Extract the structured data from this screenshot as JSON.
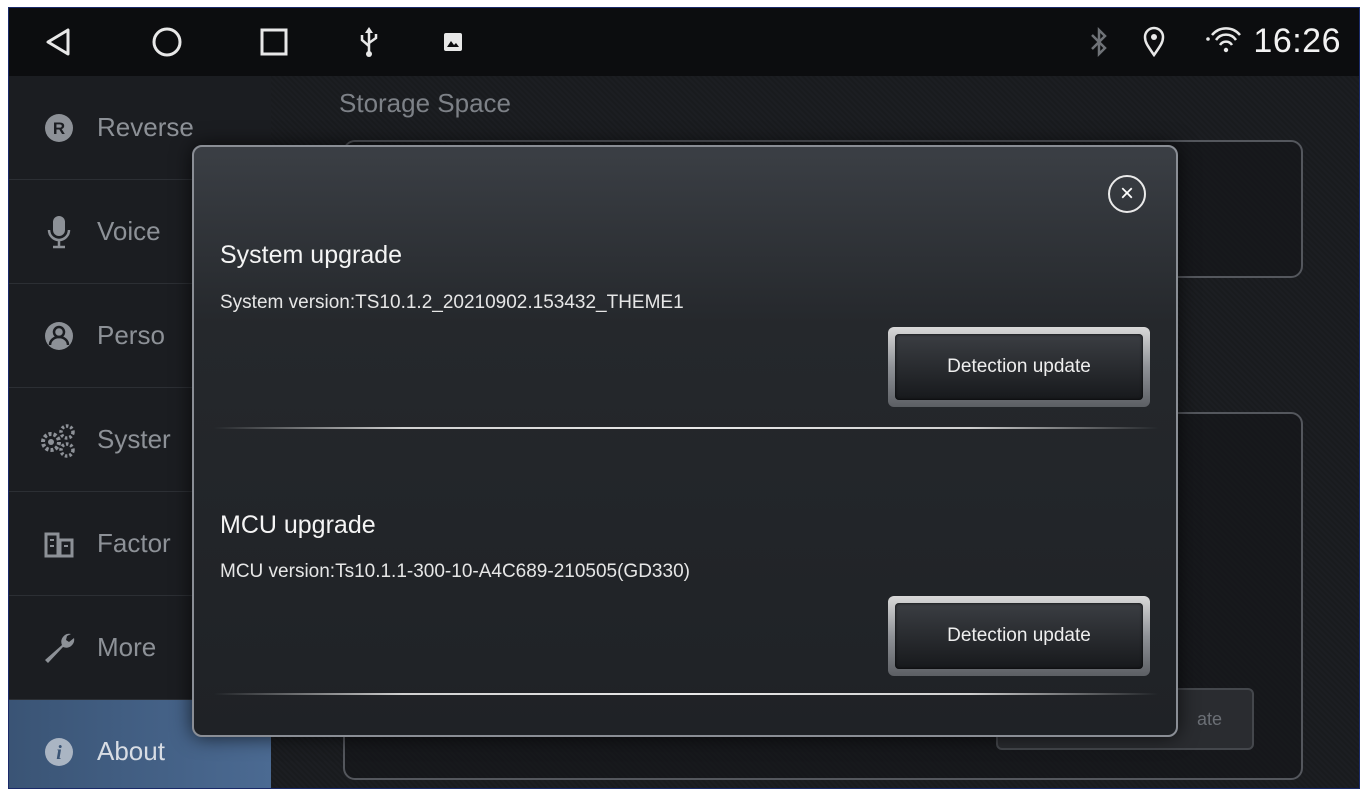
{
  "statusbar": {
    "time": "16:26",
    "icons": [
      "back-triangle-icon",
      "home-circle-icon",
      "recents-square-icon",
      "usb-icon",
      "image-icon",
      "bluetooth-icon",
      "location-pin-icon",
      "wifi-icon"
    ]
  },
  "sidebar": {
    "items": [
      {
        "label": "Reverse",
        "icon": "reverse-r-icon"
      },
      {
        "label": "Voice",
        "icon": "microphone-icon"
      },
      {
        "label": "Perso",
        "icon": "person-icon"
      },
      {
        "label": "Syster",
        "icon": "gears-icon"
      },
      {
        "label": "Factor",
        "icon": "factory-icon"
      },
      {
        "label": "More",
        "icon": "wrench-icon"
      },
      {
        "label": "About",
        "icon": "info-icon"
      }
    ]
  },
  "main": {
    "storage_title": "Storage Space",
    "bg_button_fragment": "ate"
  },
  "dialog": {
    "system": {
      "title": "System upgrade",
      "version": "System version:TS10.1.2_20210902.153432_THEME1",
      "button": "Detection update"
    },
    "mcu": {
      "title": "MCU upgrade",
      "version": "MCU version:Ts10.1.1-300-10-A4C689-210505(GD330)",
      "button": "Detection update"
    },
    "close_glyph": "×"
  },
  "colors": {
    "active_item": "#4b6a92",
    "background": "#16181b"
  }
}
